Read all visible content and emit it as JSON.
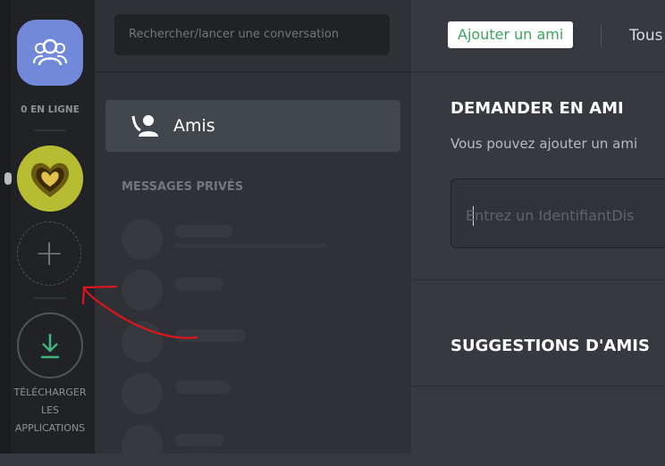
{
  "rail": {
    "home_icon": "friends-group-icon",
    "online_label": "0 EN LIGNE",
    "add_server_glyph": "+",
    "download_label_lines": [
      "TÉLÉCHARGER",
      "LES",
      "APPLICATIONS"
    ]
  },
  "dms": {
    "search_placeholder": "Rechercher/lancer une conversation",
    "friends_label": "Amis",
    "section_title": "MESSAGES PRIVÉS"
  },
  "main": {
    "tab_add_friend": "Ajouter un ami",
    "tab_all": "Tous",
    "request_title": "DEMANDER EN AMI",
    "request_desc": "Vous pouvez ajouter un ami",
    "input_placeholder": "Entrez un IdentifiantDis",
    "suggestions_title": "SUGGESTIONS D'AMIS"
  },
  "colors": {
    "accent": "#7289da",
    "green": "#43b581",
    "annotation_red": "#e0141b"
  }
}
